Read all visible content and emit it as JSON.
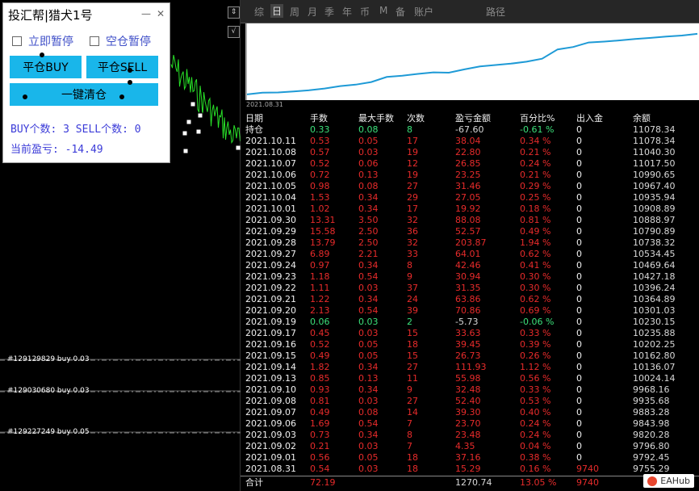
{
  "ea": {
    "title": "投汇帮|猎犬1号",
    "min_label": "—",
    "close_label": "✕",
    "pause_now_label": "立即暂停",
    "pause_flat_label": "空仓暂停",
    "close_buy_label": "平仓BUY",
    "close_sell_label": "平仓SELL",
    "close_all_label": "一键清仓",
    "buy_count_line": "BUY个数: 3   SELL个数: 0",
    "pnl_line": "当前盈亏: -14.49"
  },
  "chart": {
    "orders": [
      "#129129829 buy 0.03",
      "#129030680 buy 0.03",
      "#129227249 buy 0.05"
    ],
    "line_color": "#28e028"
  },
  "stats": {
    "tabs": [
      "综",
      "日",
      "周",
      "月",
      "季",
      "年",
      "币",
      "M",
      "备",
      "账户",
      "路径"
    ],
    "active_tab": "日",
    "equity_start_date": "2021.08.31",
    "headers": [
      "日期",
      "手数",
      "最大手数",
      "次数",
      "盈亏金额",
      "百分比%",
      "出入金",
      "余额"
    ],
    "holding": {
      "label": "持仓",
      "lots": "0.33",
      "max": "0.08",
      "count": "8",
      "pnl": "-67.60",
      "pct": "-0.61 %",
      "io": "0",
      "balance": "11078.34"
    },
    "rows": [
      [
        "2021.10.11",
        "0.53",
        "0.05",
        "17",
        "38.04",
        "0.34 %",
        "0",
        "11078.34"
      ],
      [
        "2021.10.08",
        "0.57",
        "0.03",
        "19",
        "22.80",
        "0.21 %",
        "0",
        "11040.30"
      ],
      [
        "2021.10.07",
        "0.52",
        "0.06",
        "12",
        "26.85",
        "0.24 %",
        "0",
        "11017.50"
      ],
      [
        "2021.10.06",
        "0.72",
        "0.13",
        "19",
        "23.25",
        "0.21 %",
        "0",
        "10990.65"
      ],
      [
        "2021.10.05",
        "0.98",
        "0.08",
        "27",
        "31.46",
        "0.29 %",
        "0",
        "10967.40"
      ],
      [
        "2021.10.04",
        "1.53",
        "0.34",
        "29",
        "27.05",
        "0.25 %",
        "0",
        "10935.94"
      ],
      [
        "2021.10.01",
        "1.02",
        "0.34",
        "17",
        "19.92",
        "0.18 %",
        "0",
        "10908.89"
      ],
      [
        "2021.09.30",
        "13.31",
        "3.50",
        "32",
        "88.08",
        "0.81 %",
        "0",
        "10888.97"
      ],
      [
        "2021.09.29",
        "15.58",
        "2.50",
        "36",
        "52.57",
        "0.49 %",
        "0",
        "10790.89"
      ],
      [
        "2021.09.28",
        "13.79",
        "2.50",
        "32",
        "203.87",
        "1.94 %",
        "0",
        "10738.32"
      ],
      [
        "2021.09.27",
        "6.89",
        "2.21",
        "33",
        "64.01",
        "0.62 %",
        "0",
        "10534.45"
      ],
      [
        "2021.09.24",
        "0.97",
        "0.34",
        "8",
        "42.46",
        "0.41 %",
        "0",
        "10469.64"
      ],
      [
        "2021.09.23",
        "1.18",
        "0.54",
        "9",
        "30.94",
        "0.30 %",
        "0",
        "10427.18"
      ],
      [
        "2021.09.22",
        "1.11",
        "0.03",
        "37",
        "31.35",
        "0.30 %",
        "0",
        "10396.24"
      ],
      [
        "2021.09.21",
        "1.22",
        "0.34",
        "24",
        "63.86",
        "0.62 %",
        "0",
        "10364.89"
      ],
      [
        "2021.09.20",
        "2.13",
        "0.54",
        "39",
        "70.86",
        "0.69 %",
        "0",
        "10301.03"
      ],
      [
        "2021.09.19",
        "0.06",
        "0.03",
        "2",
        "-5.73",
        "-0.06 %",
        "0",
        "10230.15"
      ],
      [
        "2021.09.17",
        "0.45",
        "0.03",
        "15",
        "33.63",
        "0.33 %",
        "0",
        "10235.88"
      ],
      [
        "2021.09.16",
        "0.52",
        "0.05",
        "18",
        "39.45",
        "0.39 %",
        "0",
        "10202.25"
      ],
      [
        "2021.09.15",
        "0.49",
        "0.05",
        "15",
        "26.73",
        "0.26 %",
        "0",
        "10162.80"
      ],
      [
        "2021.09.14",
        "1.82",
        "0.34",
        "27",
        "111.93",
        "1.12 %",
        "0",
        "10136.07"
      ],
      [
        "2021.09.13",
        "0.85",
        "0.13",
        "11",
        "55.98",
        "0.56 %",
        "0",
        "10024.14"
      ],
      [
        "2021.09.10",
        "0.93",
        "0.34",
        "9",
        "32.48",
        "0.33 %",
        "0",
        "9968.16"
      ],
      [
        "2021.09.08",
        "0.81",
        "0.03",
        "27",
        "52.40",
        "0.53 %",
        "0",
        "9935.68"
      ],
      [
        "2021.09.07",
        "0.49",
        "0.08",
        "14",
        "39.30",
        "0.40 %",
        "0",
        "9883.28"
      ],
      [
        "2021.09.06",
        "1.69",
        "0.54",
        "7",
        "23.70",
        "0.24 %",
        "0",
        "9843.98"
      ],
      [
        "2021.09.03",
        "0.73",
        "0.34",
        "8",
        "23.48",
        "0.24 %",
        "0",
        "9820.28"
      ],
      [
        "2021.09.02",
        "0.21",
        "0.03",
        "7",
        "4.35",
        "0.04 %",
        "0",
        "9796.80"
      ],
      [
        "2021.09.01",
        "0.56",
        "0.05",
        "18",
        "37.16",
        "0.38 %",
        "0",
        "9792.45"
      ],
      [
        "2021.08.31",
        "0.54",
        "0.03",
        "18",
        "15.29",
        "0.16 %",
        "9740",
        "9755.29"
      ]
    ],
    "total": {
      "label": "合计",
      "lots": "72.19",
      "max": "",
      "count": "",
      "pnl": "1270.74",
      "pct": "13.05 %",
      "io": "9740",
      "balance": ""
    },
    "watermark": "EAHub"
  }
}
